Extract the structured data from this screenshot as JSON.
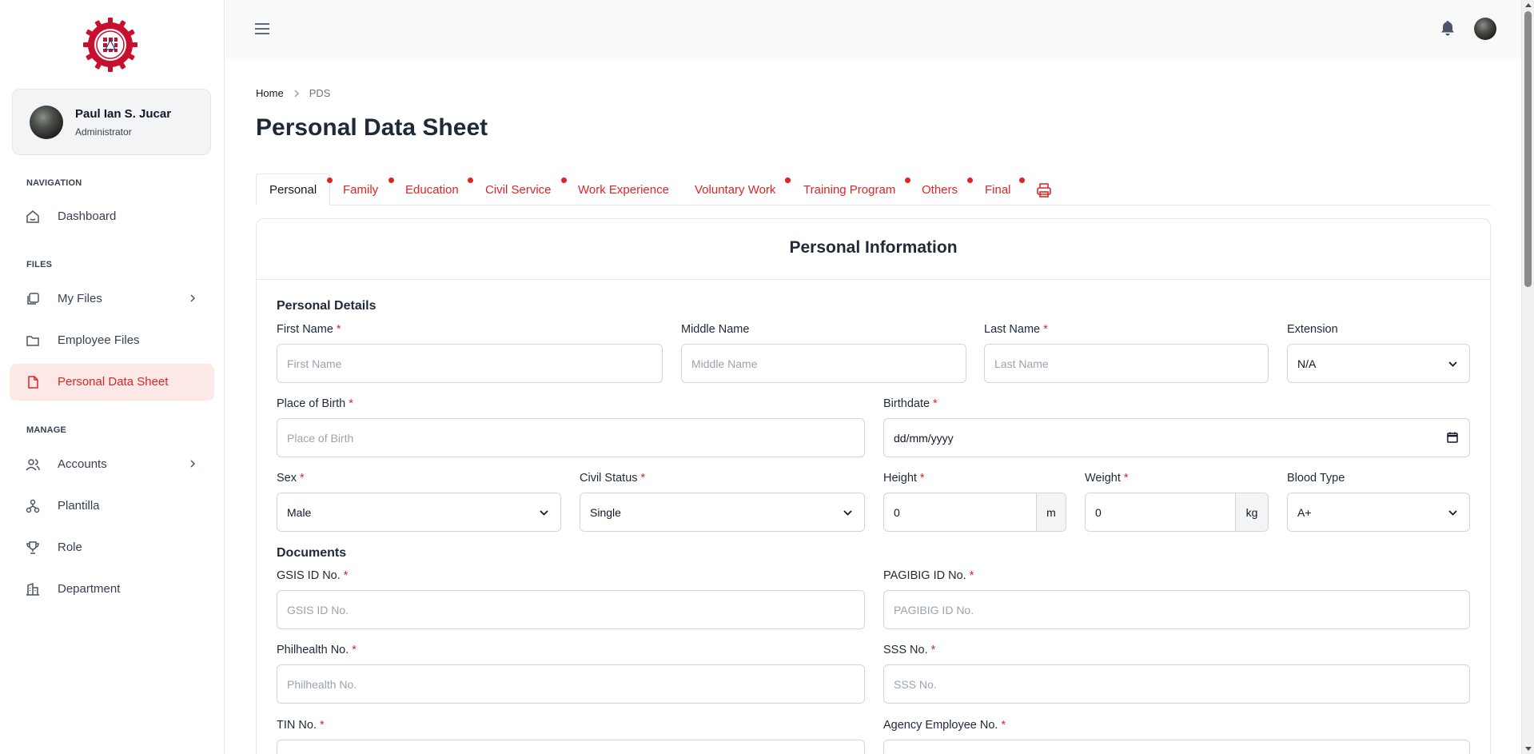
{
  "sidebar": {
    "user": {
      "name": "Paul Ian S. Jucar",
      "role": "Administrator"
    },
    "sections": {
      "navigation": "NAVIGATION",
      "files": "FILES",
      "manage": "MANAGE"
    },
    "items": {
      "dashboard": "Dashboard",
      "my_files": "My Files",
      "employee_files": "Employee Files",
      "personal_data_sheet": "Personal Data Sheet",
      "accounts": "Accounts",
      "plantilla": "Plantilla",
      "role": "Role",
      "department": "Department"
    }
  },
  "breadcrumb": {
    "home": "Home",
    "current": "PDS"
  },
  "page_title": "Personal Data Sheet",
  "tabs": {
    "personal": "Personal",
    "family": "Family",
    "education": "Education",
    "civil_service": "Civil Service",
    "work_experience": "Work Experience",
    "voluntary_work": "Voluntary Work",
    "training_program": "Training Program",
    "others": "Others",
    "final": "Final"
  },
  "card": {
    "title": "Personal Information",
    "personal_details": "Personal Details",
    "documents": "Documents"
  },
  "fields": {
    "first_name": {
      "label": "First Name",
      "placeholder": "First Name"
    },
    "middle_name": {
      "label": "Middle Name",
      "placeholder": "Middle Name"
    },
    "last_name": {
      "label": "Last Name",
      "placeholder": "Last Name"
    },
    "extension": {
      "label": "Extension",
      "value": "N/A"
    },
    "place_of_birth": {
      "label": "Place of Birth",
      "placeholder": "Place of Birth"
    },
    "birthdate": {
      "label": "Birthdate",
      "value": "dd/mm/yyyy"
    },
    "sex": {
      "label": "Sex",
      "value": "Male"
    },
    "civil_status": {
      "label": "Civil Status",
      "value": "Single"
    },
    "height": {
      "label": "Height",
      "value": "0",
      "unit": "m"
    },
    "weight": {
      "label": "Weight",
      "value": "0",
      "unit": "kg"
    },
    "blood_type": {
      "label": "Blood Type",
      "value": "A+"
    },
    "gsis": {
      "label": "GSIS ID No.",
      "placeholder": "GSIS ID No."
    },
    "pagibig": {
      "label": "PAGIBIG ID No.",
      "placeholder": "PAGIBIG ID No."
    },
    "philhealth": {
      "label": "Philhealth No.",
      "placeholder": "Philhealth No."
    },
    "sss": {
      "label": "SSS No.",
      "placeholder": "SSS No."
    },
    "tin": {
      "label": "TIN No."
    },
    "agency_employee": {
      "label": "Agency Employee No."
    }
  },
  "required_mark": "*",
  "colors": {
    "accent": "#dc2626",
    "active_bg": "#fde8e8"
  }
}
